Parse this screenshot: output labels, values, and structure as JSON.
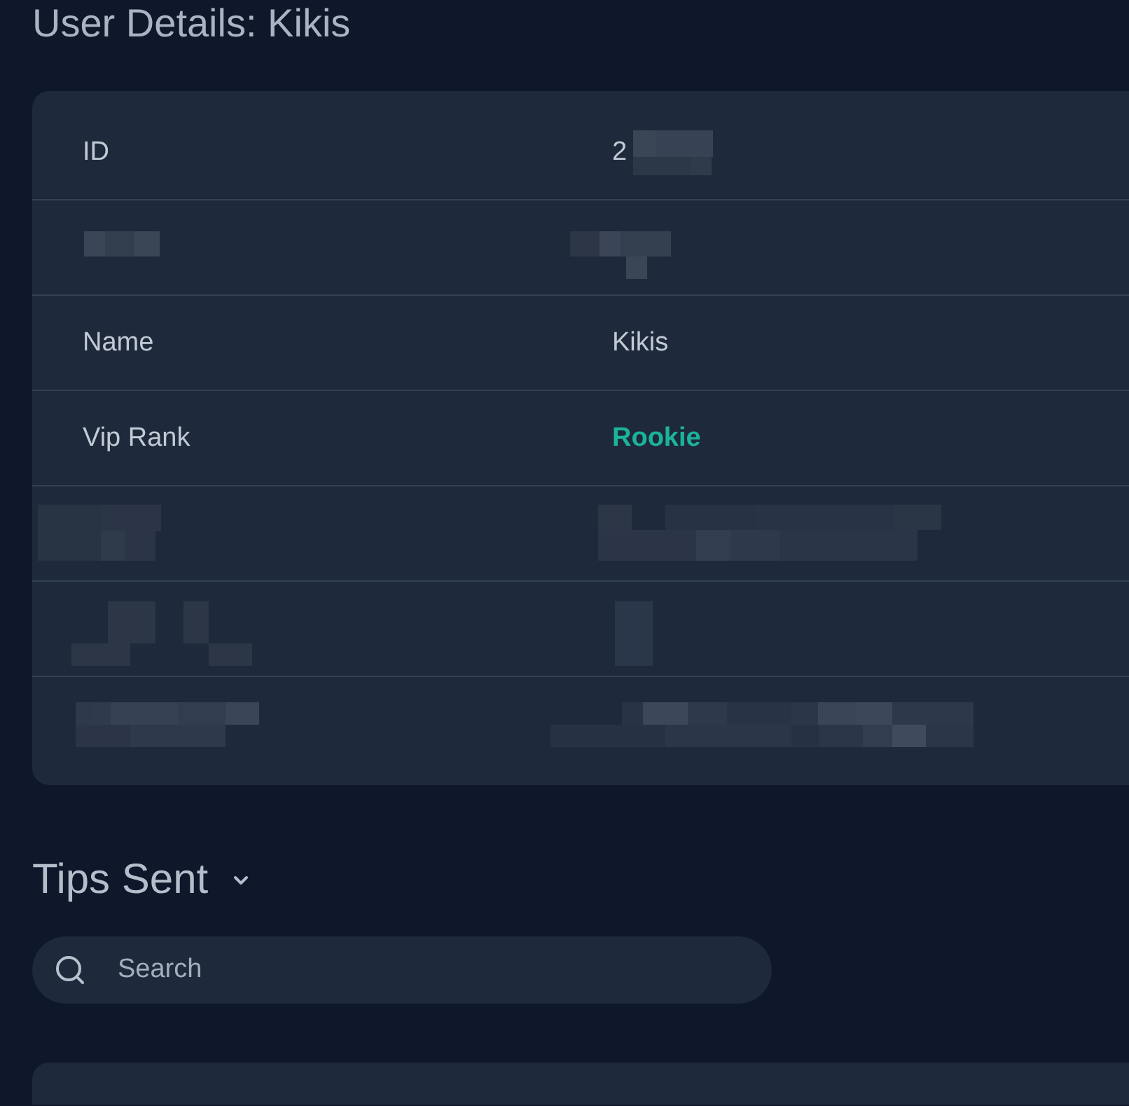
{
  "page": {
    "title": "User Details: Kikis"
  },
  "details": {
    "rows": [
      {
        "kind": "plain",
        "label": "ID",
        "value": "2",
        "value_masked": true
      },
      {
        "kind": "masked"
      },
      {
        "kind": "plain",
        "label": "Name",
        "value": "Kikis"
      },
      {
        "kind": "rank",
        "label": "Vip Rank",
        "value": "Rookie"
      },
      {
        "kind": "masked"
      },
      {
        "kind": "masked"
      },
      {
        "kind": "masked"
      }
    ]
  },
  "tips_section": {
    "title": "Tips Sent",
    "search": {
      "placeholder": "Search"
    }
  }
}
